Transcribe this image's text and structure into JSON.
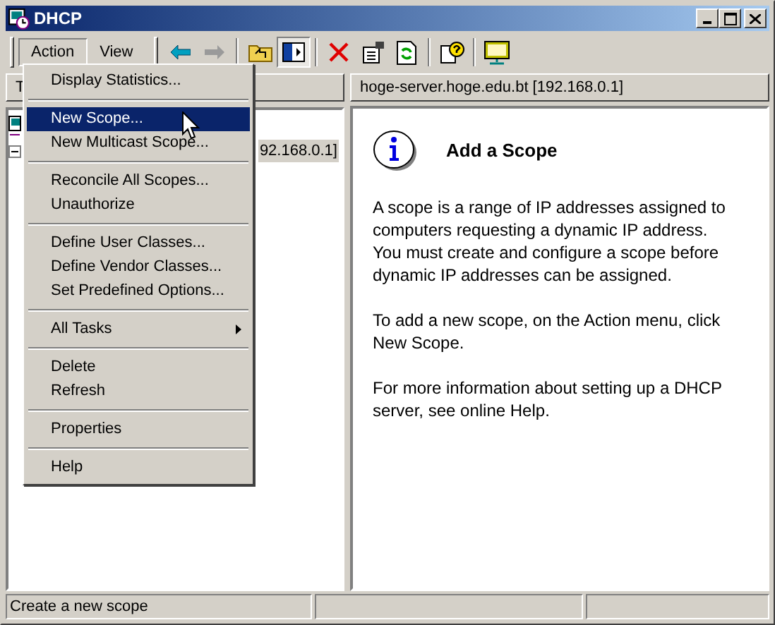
{
  "window": {
    "title": "DHCP"
  },
  "menubar": [
    {
      "label": "Action",
      "selected": true
    },
    {
      "label": "View",
      "selected": false
    }
  ],
  "toolbar": [
    {
      "kind": "back",
      "disabled": false,
      "pressed": false
    },
    {
      "kind": "forward",
      "disabled": true,
      "pressed": false
    },
    {
      "kind": "sep"
    },
    {
      "kind": "up",
      "disabled": false,
      "pressed": false
    },
    {
      "kind": "tree",
      "disabled": false,
      "pressed": true
    },
    {
      "kind": "sep"
    },
    {
      "kind": "delete",
      "disabled": false,
      "pressed": false
    },
    {
      "kind": "properties",
      "disabled": false,
      "pressed": false
    },
    {
      "kind": "refresh",
      "disabled": false,
      "pressed": false
    },
    {
      "kind": "sep"
    },
    {
      "kind": "help",
      "disabled": false,
      "pressed": false
    },
    {
      "kind": "sep"
    },
    {
      "kind": "console",
      "disabled": false,
      "pressed": false
    }
  ],
  "left_pane": {
    "header": "T",
    "tree": [
      {
        "children": [
          {
            "label": "92.168.0.1]",
            "expanded": true
          }
        ]
      }
    ]
  },
  "menu": [
    {
      "kind": "item",
      "label": "Display Statistics...",
      "selected": false
    },
    {
      "kind": "sep"
    },
    {
      "kind": "item",
      "label": "New Scope...",
      "selected": true
    },
    {
      "kind": "item",
      "label": "New Multicast Scope...",
      "selected": false
    },
    {
      "kind": "sep"
    },
    {
      "kind": "item",
      "label": "Reconcile All Scopes...",
      "selected": false
    },
    {
      "kind": "item",
      "label": "Unauthorize",
      "selected": false
    },
    {
      "kind": "sep"
    },
    {
      "kind": "item",
      "label": "Define User Classes...",
      "selected": false
    },
    {
      "kind": "item",
      "label": "Define Vendor Classes...",
      "selected": false
    },
    {
      "kind": "item",
      "label": "Set Predefined Options...",
      "selected": false
    },
    {
      "kind": "sep"
    },
    {
      "kind": "submenu",
      "label": "All Tasks",
      "selected": false
    },
    {
      "kind": "sep"
    },
    {
      "kind": "item",
      "label": "Delete",
      "selected": false
    },
    {
      "kind": "item",
      "label": "Refresh",
      "selected": false
    },
    {
      "kind": "sep"
    },
    {
      "kind": "item",
      "label": "Properties",
      "selected": false
    },
    {
      "kind": "sep"
    },
    {
      "kind": "item",
      "label": "Help",
      "selected": false
    }
  ],
  "right_pane": {
    "header": "hoge-server.hoge.edu.bt [192.168.0.1]",
    "title": "Add a Scope",
    "paragraphs": [
      "A scope is a range of IP addresses assigned to computers requesting a dynamic IP address. You must create and configure a scope before dynamic IP addresses can be assigned.",
      "To add a new scope, on the Action menu, click New Scope.",
      "For more information about setting up a DHCP server, see online Help."
    ]
  },
  "status_bar": [
    "Create a new scope"
  ]
}
